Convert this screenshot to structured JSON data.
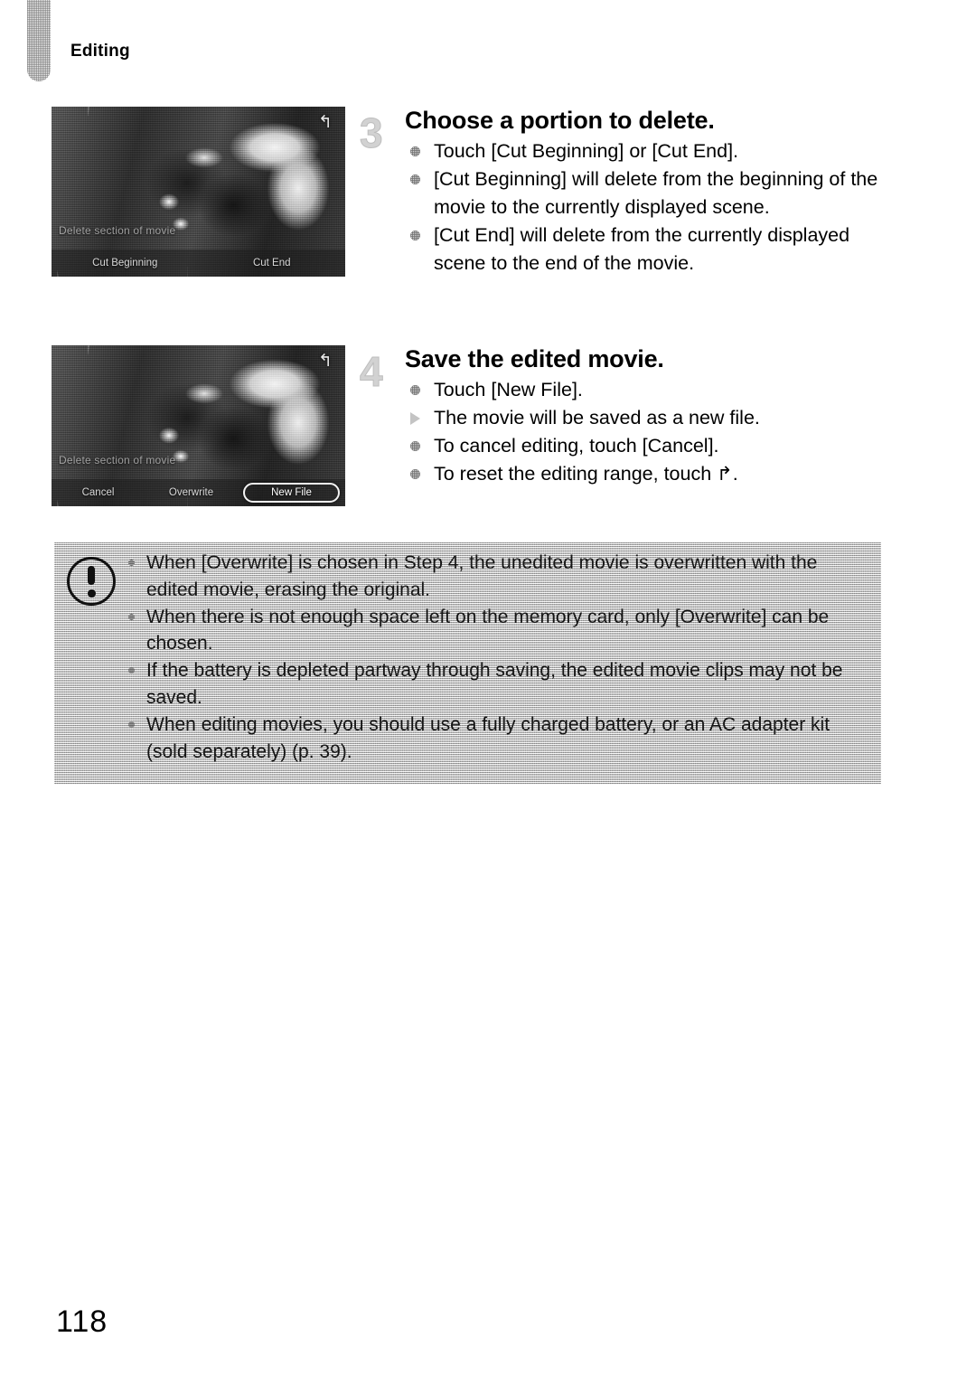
{
  "page": {
    "running_head": "Editing",
    "folio": "118"
  },
  "steps": [
    {
      "number": "3",
      "title": "Choose a portion to delete.",
      "bullets": [
        {
          "marker": "dot",
          "text": "Touch [Cut Beginning] or [Cut End]."
        },
        {
          "marker": "dot",
          "text": "[Cut Beginning] will delete from the beginning of the movie to the currently displayed scene."
        },
        {
          "marker": "dot",
          "text": "[Cut End] will delete from the currently displayed scene to the end of the movie."
        }
      ],
      "screenshot": {
        "hint_label": "Delete section of movie",
        "return_icon": "return-arrow-icon",
        "buttons": [
          {
            "label": "Cut Beginning",
            "selected": false
          },
          {
            "label": "Cut End",
            "selected": false
          }
        ]
      }
    },
    {
      "number": "4",
      "title": "Save the edited movie.",
      "bullets": [
        {
          "marker": "dot",
          "text": "Touch [New File]."
        },
        {
          "marker": "triangle",
          "text": "The movie will be saved as a new file."
        },
        {
          "marker": "dot",
          "text": "To cancel editing, touch [Cancel]."
        },
        {
          "marker": "dot",
          "text": "To reset the editing range, touch ",
          "suffix_icon": "return-arrow-icon",
          "suffix_text": "."
        }
      ],
      "screenshot": {
        "hint_label": "Delete section of movie",
        "return_icon": "return-arrow-icon",
        "buttons": [
          {
            "label": "Cancel",
            "selected": false
          },
          {
            "label": "Overwrite",
            "selected": false
          },
          {
            "label": "New File",
            "selected": true
          }
        ]
      }
    }
  ],
  "caution": {
    "icon": "exclamation-circle-icon",
    "items": [
      "When [Overwrite] is chosen in Step 4, the unedited movie is overwritten with the edited movie, erasing the original.",
      "When there is not enough space left on the memory card, only [Overwrite] can be chosen.",
      "If the battery is depleted partway through saving, the edited movie clips may not be saved.",
      "When editing movies, you should use a fully charged battery, or an AC adapter kit (sold separately) (p. 39)."
    ]
  },
  "glyphs": {
    "return_arrow": "↰"
  },
  "colors": {
    "page_background": "#ffffff",
    "text": "#000000",
    "step_number": "#d2d2d2",
    "caution_background": "#d9d9d9",
    "bullet": "#cfcfcf"
  }
}
